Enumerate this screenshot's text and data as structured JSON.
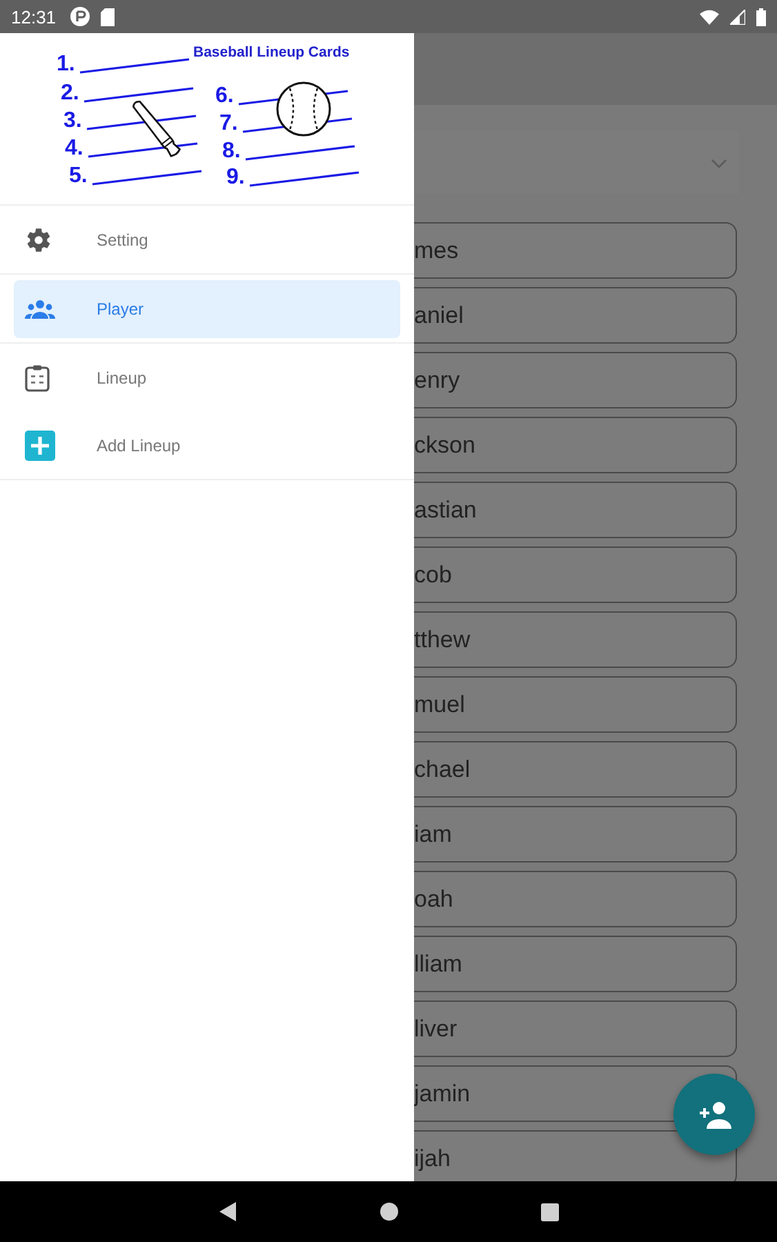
{
  "status_bar": {
    "time": "12:31"
  },
  "drawer": {
    "logo": {
      "title": "Baseball Lineup Cards",
      "numbers": [
        "1.",
        "2.",
        "3.",
        "4.",
        "5.",
        "6.",
        "7.",
        "8.",
        "9."
      ]
    },
    "items": [
      {
        "kind": "settings",
        "label": "Setting",
        "selected": false
      },
      {
        "kind": "players",
        "label": "Player",
        "selected": true
      },
      {
        "kind": "lineup",
        "label": "Lineup",
        "selected": false
      },
      {
        "kind": "add",
        "label": "Add Lineup",
        "selected": false
      }
    ]
  },
  "players": [
    {
      "name": "mes"
    },
    {
      "name": "aniel"
    },
    {
      "name": "enry"
    },
    {
      "name": "ckson"
    },
    {
      "name": "astian"
    },
    {
      "name": "cob"
    },
    {
      "name": "tthew"
    },
    {
      "name": "muel"
    },
    {
      "name": "chael"
    },
    {
      "name": "iam"
    },
    {
      "name": "oah"
    },
    {
      "name": "lliam"
    },
    {
      "name": "liver"
    },
    {
      "name": "jamin"
    },
    {
      "name": "ijah"
    }
  ]
}
